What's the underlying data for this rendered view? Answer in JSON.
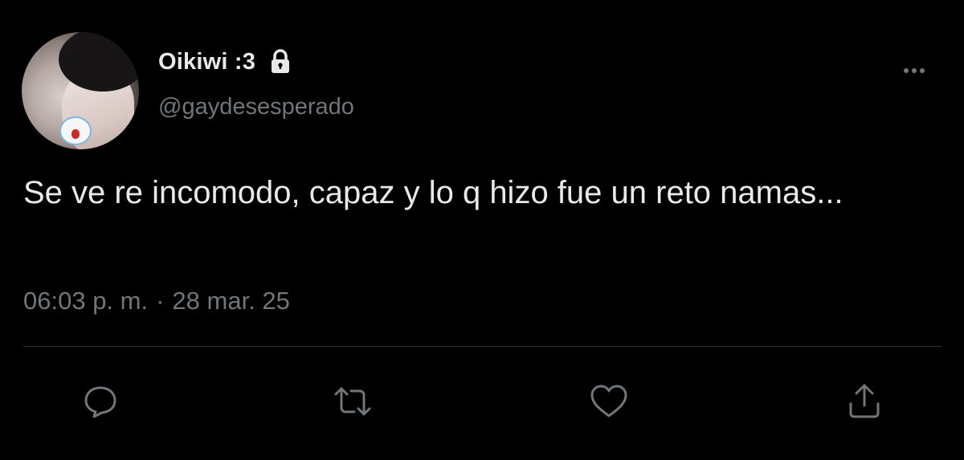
{
  "user": {
    "display_name": "Oikiwi :3",
    "handle": "@gaydesesperado",
    "protected_icon": "lock-icon",
    "avatar": "profile-photo"
  },
  "tweet": {
    "text": "Se ve re incomodo, capaz y lo q hizo fue un reto namas...",
    "time": "06:03 p. m.",
    "separator": "·",
    "date": "28 mar. 25"
  },
  "actions": [
    {
      "name": "reply",
      "icon": "speech-bubble-icon"
    },
    {
      "name": "retweet",
      "icon": "retweet-arrows-icon"
    },
    {
      "name": "like",
      "icon": "heart-icon"
    },
    {
      "name": "share",
      "icon": "share-arrow-icon"
    }
  ],
  "colors": {
    "background": "#000000",
    "primary_text": "#e7e9ea",
    "secondary_text": "#71767b",
    "divider": "#2f3336"
  }
}
